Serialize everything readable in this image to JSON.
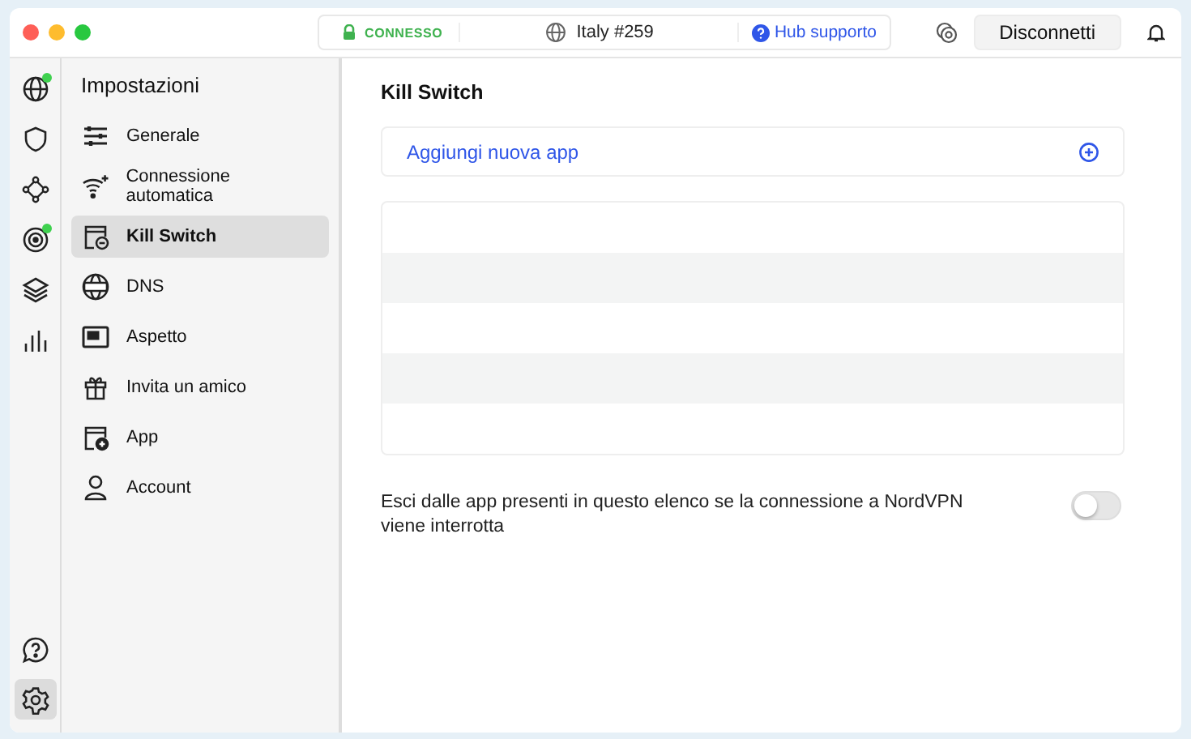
{
  "titlebar": {
    "status": "CONNESSO",
    "connected": true,
    "server": "Italy #259",
    "help_link": "Hub supporto",
    "disconnect_button": "Disconnetti"
  },
  "rail": {
    "top": [
      {
        "kind": "globe",
        "badge": true,
        "selected": false
      },
      {
        "kind": "shield",
        "badge": false,
        "selected": false
      },
      {
        "kind": "mesh",
        "badge": false,
        "selected": false
      },
      {
        "kind": "radar",
        "badge": true,
        "selected": false
      },
      {
        "kind": "layers",
        "badge": false,
        "selected": false
      },
      {
        "kind": "stats",
        "badge": false,
        "selected": false
      }
    ],
    "bottom": [
      {
        "kind": "help",
        "badge": false,
        "selected": false
      },
      {
        "kind": "settings",
        "badge": false,
        "selected": true
      }
    ]
  },
  "sidebar": {
    "title": "Impostazioni",
    "items": [
      {
        "kind": "sliders",
        "label": "Generale",
        "selected": false
      },
      {
        "kind": "wifi",
        "label": "Connessione automatica",
        "selected": false
      },
      {
        "kind": "killswitch",
        "label": "Kill Switch",
        "selected": true
      },
      {
        "kind": "dns",
        "label": "DNS",
        "selected": false
      },
      {
        "kind": "window",
        "label": "Aspetto",
        "selected": false
      },
      {
        "kind": "gift",
        "label": "Invita un amico",
        "selected": false
      },
      {
        "kind": "appadd",
        "label": "App",
        "selected": false
      },
      {
        "kind": "person",
        "label": "Account",
        "selected": false
      }
    ]
  },
  "main": {
    "title": "Kill Switch",
    "add_app": "Aggiungi nuova app",
    "toggle": {
      "label": "Esci dalle app presenti in questo elenco se la connessione a NordVPN viene interrotta",
      "on": false
    }
  }
}
